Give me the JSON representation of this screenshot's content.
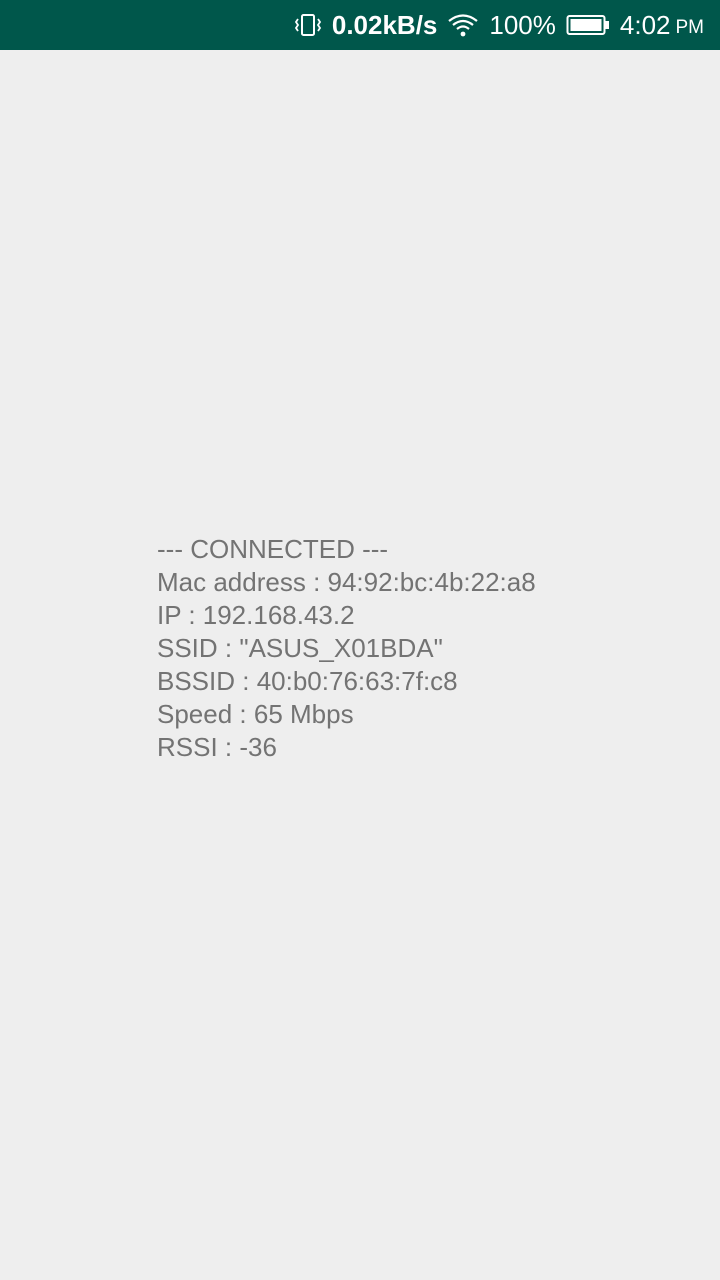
{
  "status_bar": {
    "net_speed": "0.02kB/s",
    "battery": "100%",
    "time": "4:02",
    "ampm": "PM",
    "icons": [
      "vibrate-icon",
      "wifi-icon",
      "battery-icon"
    ]
  },
  "wifi_info": {
    "connected": "--- CONNECTED ---",
    "mac": "Mac address : 94:92:bc:4b:22:a8",
    "ip": "IP : 192.168.43.2",
    "ssid": "SSID : \"ASUS_X01BDA\"",
    "bssid": "BSSID : 40:b0:76:63:7f:c8",
    "speed": "Speed : 65 Mbps",
    "rssi": "RSSI : -36"
  },
  "colors": {
    "status_bar_bg": "#00574b",
    "background": "#eeeeee",
    "text": "#737373"
  }
}
